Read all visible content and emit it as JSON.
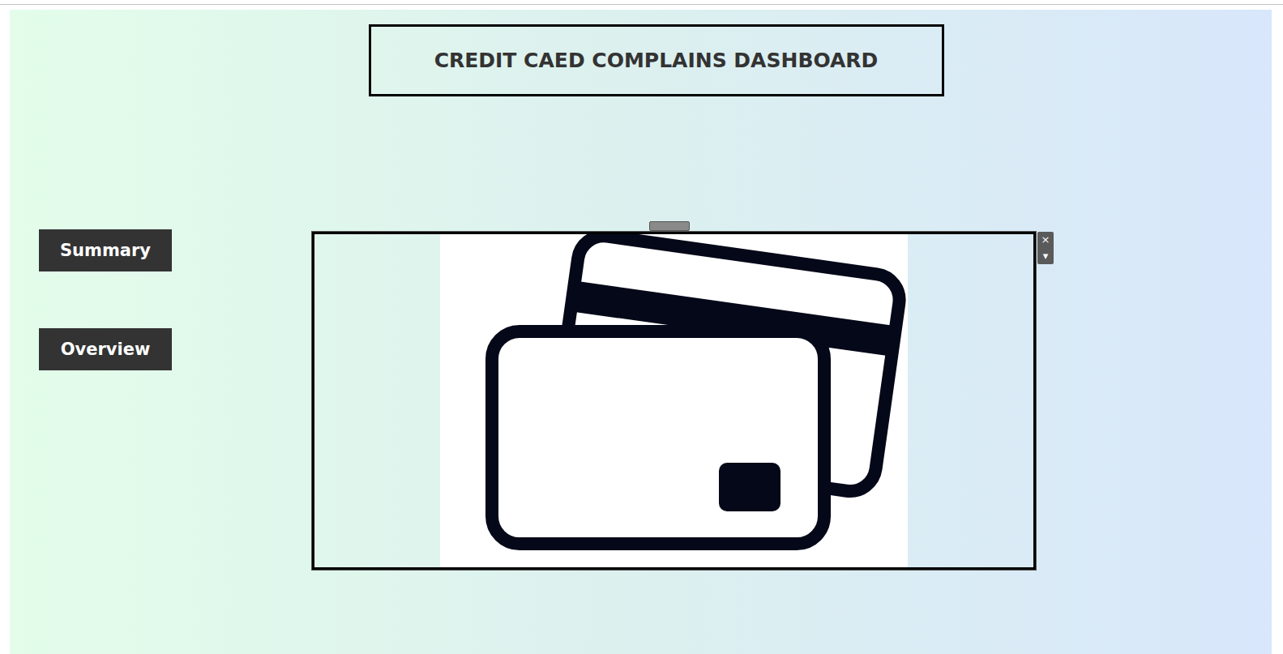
{
  "dashboard": {
    "title": "CREDIT CAED COMPLAINS DASHBOARD"
  },
  "nav_buttons": [
    {
      "label": "Summary",
      "selected": false
    },
    {
      "label": "Overview",
      "selected": false
    }
  ],
  "picture": {
    "selected": true,
    "controls": [
      {
        "label": "×"
      },
      {
        "label": "▾"
      }
    ]
  }
}
